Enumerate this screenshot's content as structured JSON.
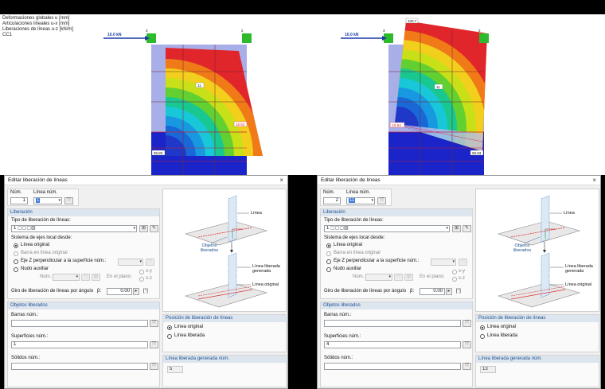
{
  "viewport": {
    "info_lines": [
      "Deformaciones globales u [mm]",
      "Articulaciones lineales u-x [mm]",
      "Liberaciones de líneas u-z [kN/m]",
      "CC1"
    ],
    "left_model": {
      "load_label": "10.0 kN",
      "node_a": "3",
      "node_b": "2",
      "value_max": "16.54",
      "value_center": "11",
      "value_bottom": "98.83"
    },
    "right_model": {
      "load_label": "10.0 kN",
      "node_a": "3",
      "node_b": "2",
      "value_top": "100.7",
      "value_min": "-16.54",
      "value_center": "11",
      "value_bottom": "98.83"
    }
  },
  "colors": {
    "accent": "#1d4f91",
    "section_header": "#dde6ef",
    "selection": "#3b78d8"
  },
  "dialogs": [
    {
      "title": "Editar liberación de líneas",
      "close_icon": "×",
      "num_label": "Núm.",
      "num_value": "1",
      "linea_num_label": "Línea núm.",
      "linea_num_value": "1",
      "liberacion_header": "Liberación",
      "tipo_label": "Tipo de liberación de líneas:",
      "tipo_value": "1",
      "sistema_label": "Sistema de ejes local desde:",
      "opt_linea_original": "Línea original",
      "opt_barra": "Barra en línea original",
      "opt_eje_z": "Eje Z perpendicular a la superficie núm.:",
      "opt_nudo": "Nudo auxiliar",
      "nudo_num_label": "Núm.:",
      "en_plano_label": "En el plano:",
      "plane_xy": "x-y",
      "plane_xz": "x-z",
      "giro_label": "Giro de liberación de líneas por ángulo",
      "beta_label": "β:",
      "beta_value": "0.00",
      "beta_unit": "[°]",
      "objetos_header": "Objetos liberados",
      "barras_label": "Barras núm.:",
      "barras_value": "",
      "superficies_label": "Superficies núm.:",
      "superficies_value": "1",
      "solidos_label": "Sólidos núm.:",
      "solidos_value": "",
      "posicion_header": "Posición de liberación de líneas",
      "pos_original": "Línea original",
      "pos_liberada": "Línea liberada",
      "generada_header": "Línea liberada generada núm.",
      "generada_value": "5",
      "ill_linea": "Línea",
      "ill_objetos": "Objetos liberados",
      "ill_linea_liberada": "Línea liberada generada",
      "ill_linea_original": "Línea original"
    },
    {
      "title": "Editar liberación de líneas",
      "close_icon": "×",
      "num_label": "Núm.",
      "num_value": "2",
      "linea_num_label": "Línea núm.",
      "linea_num_value": "11",
      "liberacion_header": "Liberación",
      "tipo_label": "Tipo de liberación de líneas:",
      "tipo_value": "1",
      "sistema_label": "Sistema de ejes local desde:",
      "opt_linea_original": "Línea original",
      "opt_barra": "Barra en línea original",
      "opt_eje_z": "Eje Z perpendicular a la superficie núm.:",
      "opt_nudo": "Nudo auxiliar",
      "nudo_num_label": "Núm.:",
      "en_plano_label": "En el plano:",
      "plane_xy": "x-y",
      "plane_xz": "x-z",
      "giro_label": "Giro de liberación de líneas por ángulo",
      "beta_label": "β:",
      "beta_value": "0.00",
      "beta_unit": "[°]",
      "objetos_header": "Objetos liberados",
      "barras_label": "Barras núm.:",
      "barras_value": "",
      "superficies_label": "Superficies núm.:",
      "superficies_value": "4",
      "solidos_label": "Sólidos núm.:",
      "solidos_value": "",
      "posicion_header": "Posición de liberación de líneas",
      "pos_original": "Línea original",
      "pos_liberada": "Línea liberada",
      "generada_header": "Línea liberada generada núm.",
      "generada_value": "13",
      "ill_linea": "Línea",
      "ill_objetos": "Objetos liberados",
      "ill_linea_liberada": "Línea liberada generada",
      "ill_linea_original": "Línea original"
    }
  ]
}
